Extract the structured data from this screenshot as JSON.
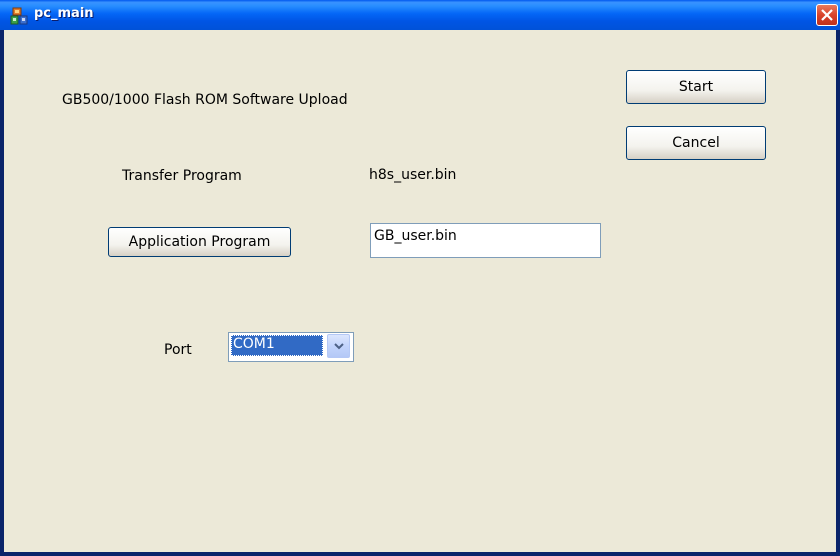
{
  "window": {
    "title": "pc_main",
    "app_icon": "application-icon",
    "close_icon": "close-icon"
  },
  "main": {
    "heading": "GB500/1000 Flash ROM Software Upload",
    "transfer_program_label": "Transfer Program",
    "transfer_program_value": "h8s_user.bin",
    "application_program_button": "Application Program",
    "application_program_value": "GB_user.bin",
    "port_label": "Port",
    "port_selected": "COM1"
  },
  "buttons": {
    "start": "Start",
    "cancel": "Cancel"
  },
  "colors": {
    "titlebar": "#0054e3",
    "client_background": "#ece9d8",
    "selection": "#316ac5",
    "close_button": "#d9432b"
  }
}
